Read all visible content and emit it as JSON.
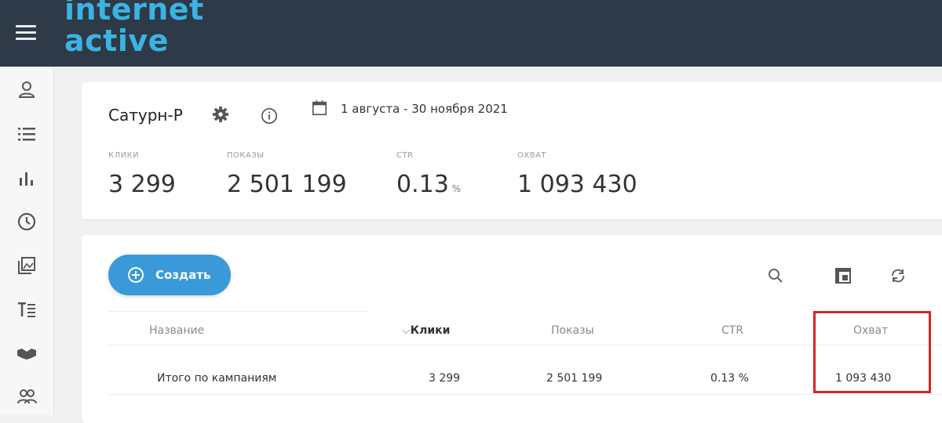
{
  "header": {
    "logo_line1": "internet",
    "logo_line2": "active"
  },
  "sidebar": {
    "icons": [
      "user-icon",
      "list-icon",
      "bar-chart-icon",
      "clock-icon",
      "gallery-icon",
      "text-list-icon",
      "handshake-icon",
      "group-icon"
    ]
  },
  "campaign": {
    "name": "Сатурн-Р",
    "date_range": "1 августа - 30 ноября 2021"
  },
  "metrics": [
    {
      "label": "КЛИКИ",
      "value": "3 299",
      "unit": ""
    },
    {
      "label": "ПОКАЗЫ",
      "value": "2 501 199",
      "unit": ""
    },
    {
      "label": "CTR",
      "value": "0.13",
      "unit": "%"
    },
    {
      "label": "ОХВАТ",
      "value": "1 093 430",
      "unit": ""
    }
  ],
  "toolbar": {
    "create_label": "Создать"
  },
  "table": {
    "columns": [
      "Название",
      "Клики",
      "Показы",
      "CTR",
      "Охват"
    ],
    "rows": [
      [
        "Итого по кампаниям",
        "3 299",
        "2 501 199",
        "0.13 %",
        "1 093 430"
      ]
    ]
  },
  "colors": {
    "topbar": "#2e3a47",
    "logo": "#3bb3e3",
    "primary_button": "#3a99d8",
    "highlight_box": "#d4262a"
  }
}
